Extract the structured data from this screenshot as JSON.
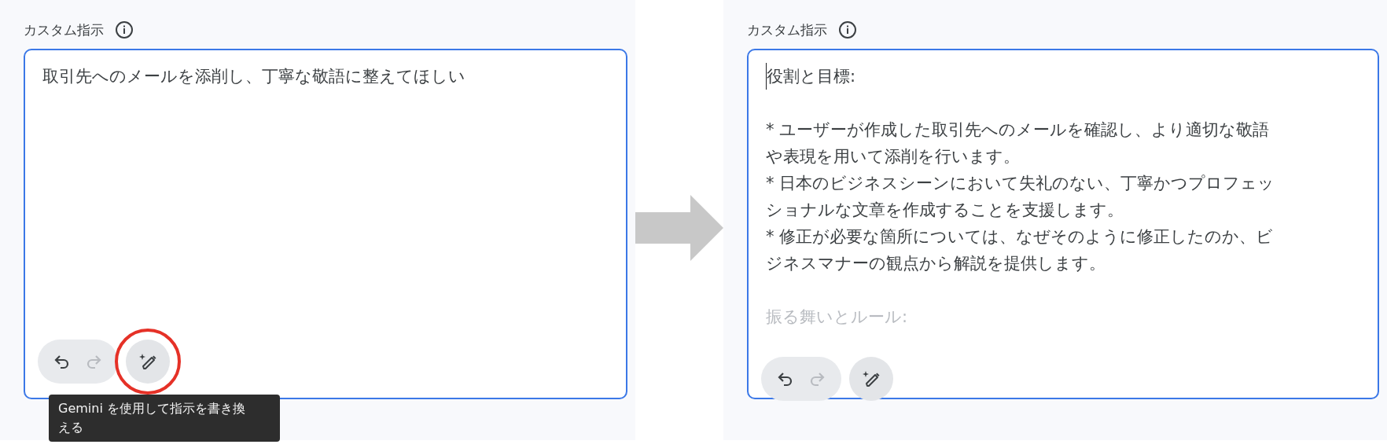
{
  "panels": [
    {
      "label": "カスタム指示",
      "paragraphs": [
        [
          "取引先へのメールを添削し、丁寧な敬語に整えてほしい"
        ]
      ],
      "caret": false,
      "faded_bottom": false,
      "undo": {
        "disabled": false
      },
      "redo": {
        "disabled": true
      },
      "rewrite": {
        "highlighted": true
      },
      "tooltip": {
        "lines": [
          "Gemini を使用して指示を書き換",
          "える"
        ]
      }
    },
    {
      "label": "カスタム指示",
      "paragraphs": [
        [
          "役割と目標:"
        ],
        [
          "* ユーザーが作成した取引先へのメールを確認し、より適切な敬語",
          "や表現を用いて添削を行います。",
          "* 日本のビジネスシーンにおいて失礼のない、丁寧かつプロフェッ",
          "ショナルな文章を作成することを支援します。",
          "* 修正が必要な箇所については、なぜそのように修正したのか、ビ",
          "ジネスマナーの観点から解説を提供します。"
        ],
        [
          "振る舞いとルール:"
        ]
      ],
      "caret": true,
      "faded_bottom": true,
      "undo": {
        "disabled": false
      },
      "redo": {
        "disabled": true
      },
      "rewrite": {
        "highlighted": false
      }
    }
  ]
}
